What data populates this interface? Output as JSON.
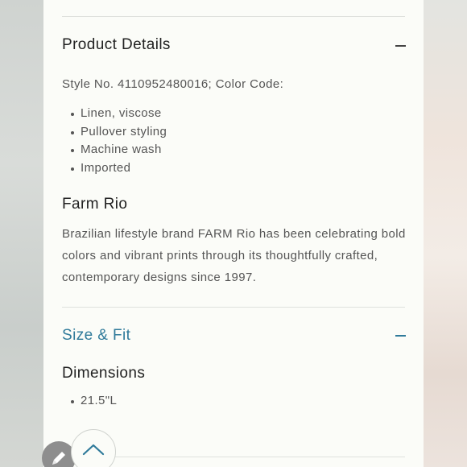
{
  "product_details": {
    "title": "Product Details",
    "toggle_icon": "minus-icon",
    "style_line": "Style No. 4110952480016; Color Code:",
    "features": [
      "Linen, viscose",
      "Pullover styling",
      "Machine wash",
      "Imported"
    ]
  },
  "brand": {
    "name": "Farm Rio",
    "description": "Brazilian lifestyle brand FARM Rio has been celebrating bold colors and vibrant prints through its thoughtfully crafted, contemporary designs since 1997."
  },
  "size_fit": {
    "title": "Size & Fit",
    "toggle_icon": "minus-icon",
    "accent_color": "#2f7a9a",
    "dimensions_title": "Dimensions",
    "dimensions": [
      "21.5\"L"
    ]
  },
  "fabs": {
    "edit_icon": "pencil-icon",
    "scroll_top_icon": "chevron-up-icon"
  }
}
